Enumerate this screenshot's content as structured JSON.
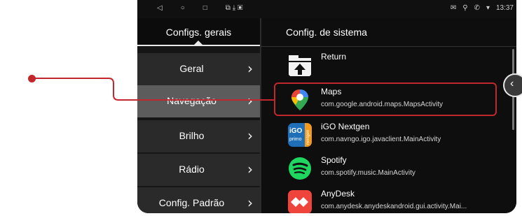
{
  "status_bar": {
    "time": "13:37",
    "nav_icons": [
      "back-icon",
      "home-icon",
      "recent-icon",
      "cast-icon",
      "download-icon",
      "image-icon"
    ],
    "right_icons": [
      "message-icon",
      "location-icon",
      "phone-icon",
      "wifi-icon"
    ]
  },
  "left_panel": {
    "title": "Configs. gerais",
    "items": [
      {
        "label": "Geral",
        "active": false
      },
      {
        "label": "Navegação",
        "active": true
      },
      {
        "label": "Brilho",
        "active": false
      },
      {
        "label": "Rádio",
        "active": false
      },
      {
        "label": "Config. Padrão",
        "active": false
      }
    ]
  },
  "right_panel": {
    "title": "Config. de sistema",
    "apps": [
      {
        "name": "Return",
        "package": "",
        "icon": "folder-return-icon"
      },
      {
        "name": "Maps",
        "package": "com.google.android.maps.MapsActivity",
        "icon": "google-maps-icon",
        "highlighted": true
      },
      {
        "name": "iGO Nextgen",
        "package": "com.navngo.igo.javaclient.MainActivity",
        "icon": "igo-icon"
      },
      {
        "name": "Spotify",
        "package": "com.spotify.music.MainActivity",
        "icon": "spotify-icon"
      },
      {
        "name": "AnyDesk",
        "package": "com.anydesk.anydeskandroid.gui.activity.Mai...",
        "icon": "anydesk-icon"
      }
    ]
  },
  "colors": {
    "annotation_red": "#c2272d",
    "active_item": "#5c5c5c",
    "panel_bg": "#161616"
  },
  "icons": {
    "igo_text_top": "iGO",
    "igo_text_bottom": "primo",
    "igo_side_text": "nextgen",
    "chevron": "›"
  }
}
